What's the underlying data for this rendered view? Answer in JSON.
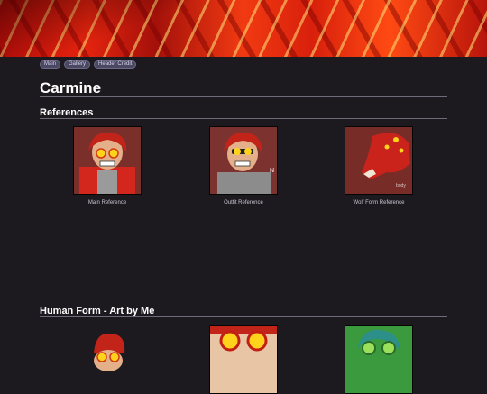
{
  "nav": [
    "Main",
    "Gallery",
    "Header Credit"
  ],
  "page_title": "Carmine",
  "sections": {
    "references": "References",
    "human_form": "Human Form - Art by Me"
  },
  "references": [
    {
      "caption": "Main Reference"
    },
    {
      "caption": "Outfit Reference"
    },
    {
      "caption": "Wolf Form Reference"
    }
  ]
}
